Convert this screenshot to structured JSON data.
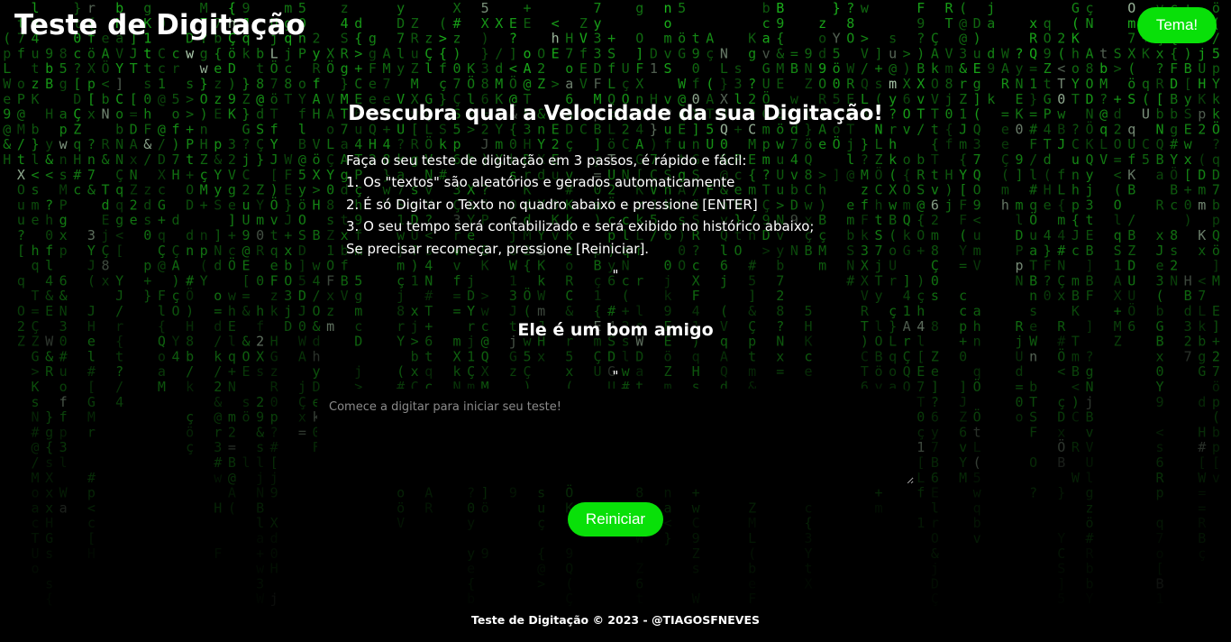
{
  "header": {
    "title": "Teste de Digitação",
    "theme_button_label": "Tema!"
  },
  "main": {
    "headline": "Descubra qual a Velocidade da sua Digitação!",
    "instructions": [
      "Faça o seu teste de digitação em 3 passos, é rápido e fácil:",
      "1. Os \"textos\" são aleatórios e gerados automaticamente",
      "2. É só Digitar o Texto no quadro abaixo e pressione [ENTER]",
      "3. O seu tempo será contabilizado e será exibido no histórico abaixo;",
      "Se precisar recomeçar, pressione [Reiniciar]."
    ],
    "quote_open": "\"",
    "phrase": "Ele é um bom amigo",
    "quote_close": "\"",
    "input": {
      "value": "",
      "placeholder": "Comece a digitar para iniciar seu teste!"
    },
    "restart_button_label": "Reiniciar"
  },
  "footer": {
    "text": "Teste de Digitação © 2023 - @TIAGOSFNEVES"
  },
  "background": {
    "style": "matrix-rain",
    "glyph_color": "#1fd11f",
    "highlight_color": "#d8ffd8",
    "base_color": "#000000"
  },
  "colors": {
    "accent": "#09e009",
    "text": "#ffffff",
    "input_background": "#000000",
    "placeholder": "#8a8a8a"
  }
}
